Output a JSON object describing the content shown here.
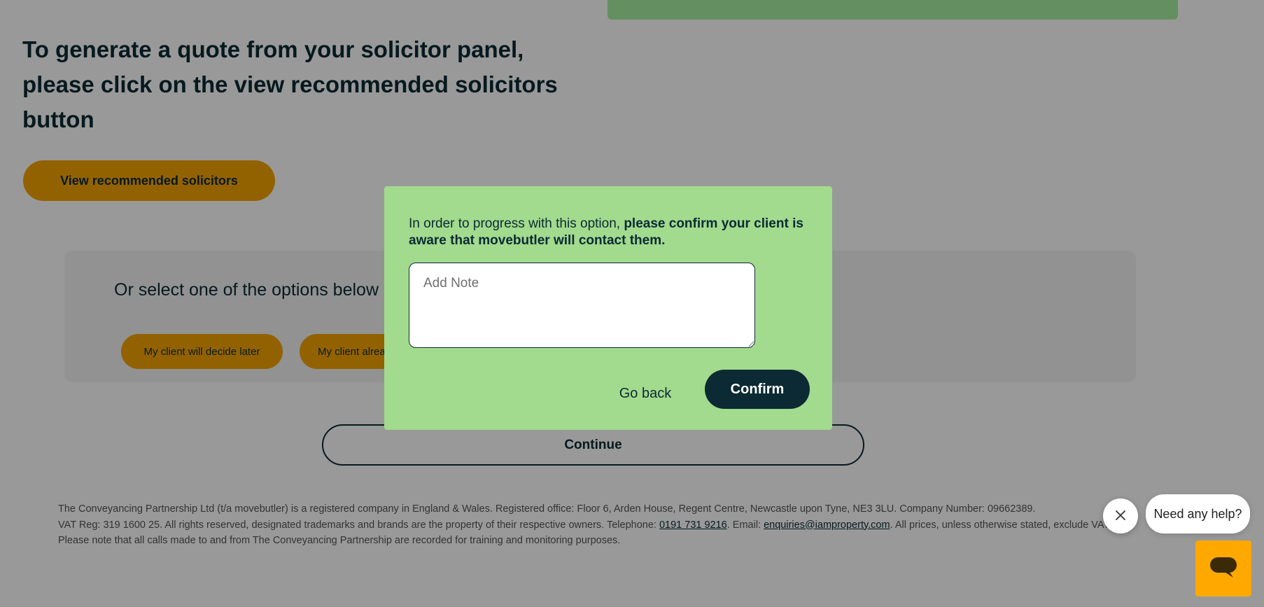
{
  "page": {
    "heading": "To generate a quote from your solicitor panel, please click on the view recommended solicitors button",
    "view_button": "View recommended solicitors",
    "options": {
      "title": "Or select one of the options below",
      "buttons": [
        "My client will decide later",
        "My client already has a solicitor"
      ]
    },
    "continue_button": "Continue"
  },
  "footer": {
    "line1": "The Conveyancing Partnership Ltd (t/a movebutler) is a registered company in England & Wales. Registered office: Floor 6, Arden House, Regent Centre, Newcastle upon Tyne, NE3 3LU. Company Number: 09662389.",
    "line2_pre": "VAT Reg: 319 1600 25. All rights reserved, designated trademarks and brands are the property of their respective owners. Telephone: ",
    "phone": "0191 731 9216",
    "line2_mid": ". Email: ",
    "email": "enquiries@iamproperty.com",
    "line2_post": ". All prices, unless otherwise stated, exclude VAT.",
    "line3": "Please note that all calls made to and from The Conveyancing Partnership are recorded for training and monitoring purposes."
  },
  "modal": {
    "text_plain": "In order to progress with this option, ",
    "text_bold": "please confirm your client is aware that movebutler will contact them.",
    "note_placeholder": "Add Note",
    "note_value": "",
    "go_back": "Go back",
    "confirm": "Confirm"
  },
  "help_widget": {
    "bubble_text": "Need any help?",
    "close_icon": "close-icon",
    "launcher_icon": "chat-icon"
  },
  "colors": {
    "brand_dark": "#0b2a33",
    "accent_yellow": "#f5a300",
    "modal_green": "#a2da8e",
    "launcher_orange": "#ffa800"
  }
}
